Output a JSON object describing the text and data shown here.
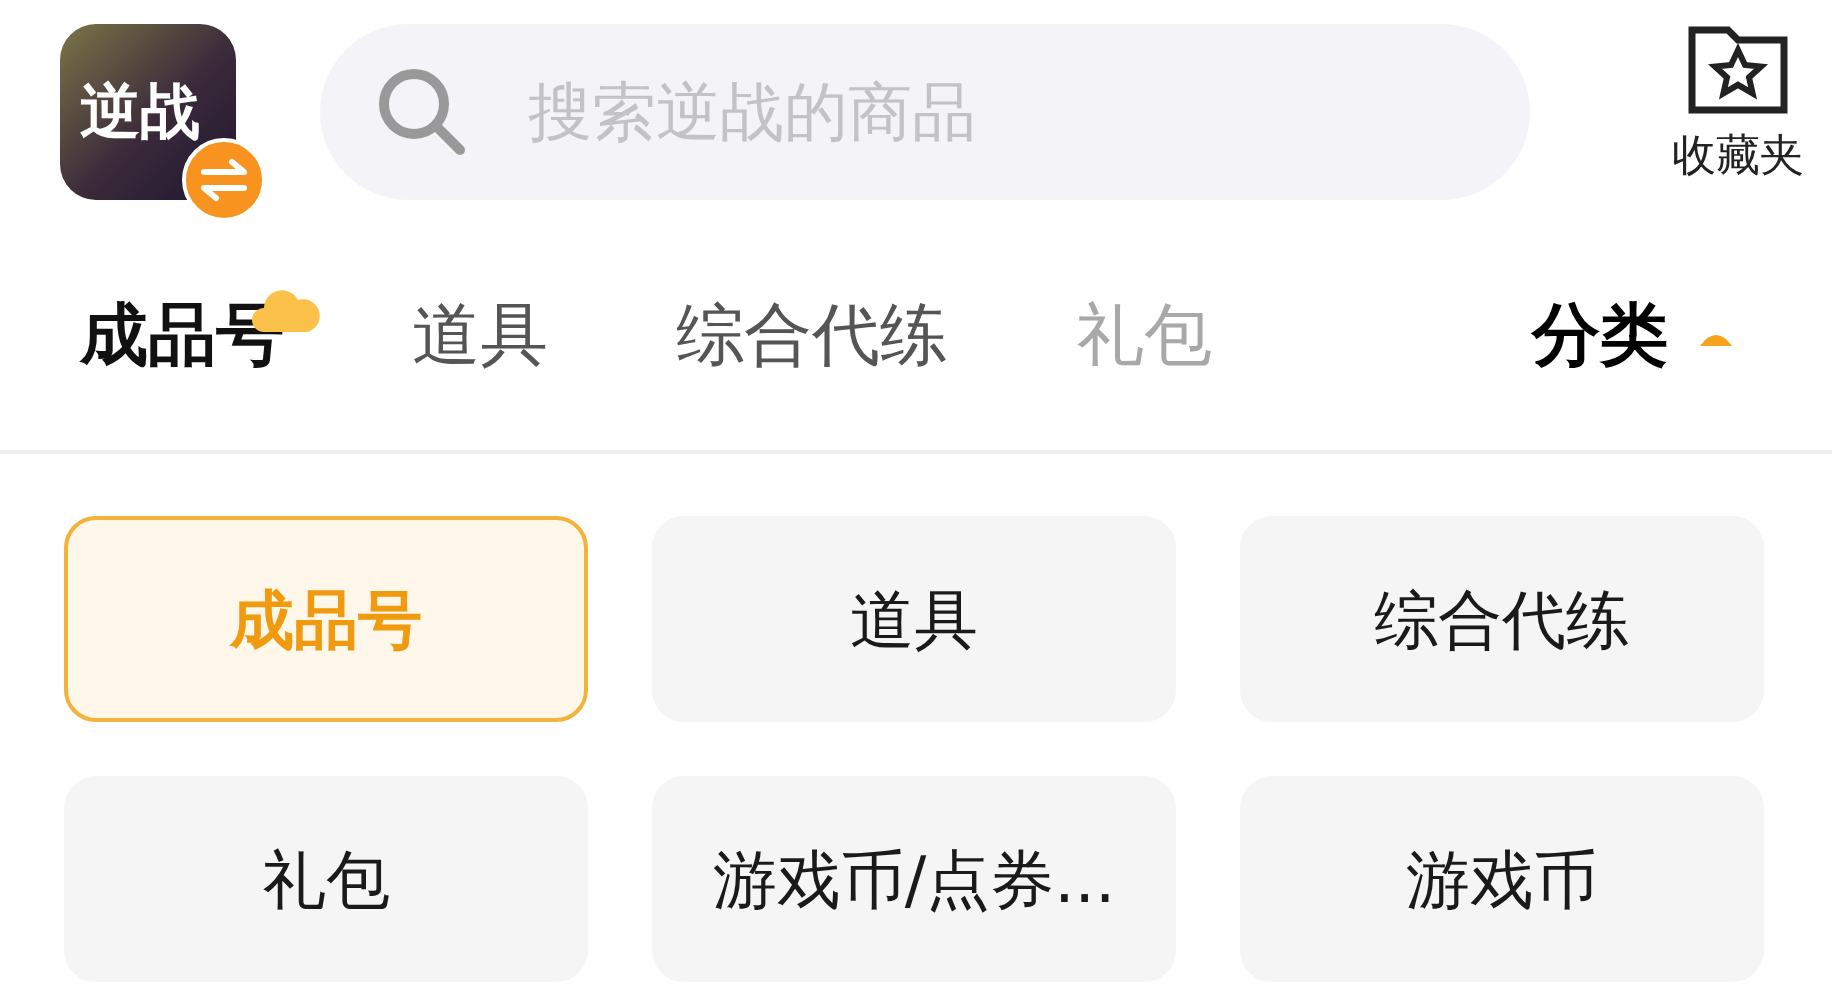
{
  "app_icon": {
    "label": "逆战"
  },
  "search": {
    "placeholder": "搜索逆战的商品"
  },
  "favorites": {
    "label": "收藏夹"
  },
  "tabs": [
    {
      "label": "成品号",
      "selected": true
    },
    {
      "label": "道具",
      "selected": false
    },
    {
      "label": "综合代练",
      "selected": false
    },
    {
      "label": "礼包",
      "selected": false
    }
  ],
  "category_toggle": {
    "label": "分类",
    "expanded": true
  },
  "categories": [
    {
      "label": "成品号",
      "selected": true
    },
    {
      "label": "道具",
      "selected": false
    },
    {
      "label": "综合代练",
      "selected": false
    },
    {
      "label": "礼包",
      "selected": false
    },
    {
      "label": "游戏币/点券...",
      "selected": false
    },
    {
      "label": "游戏币",
      "selected": false
    }
  ]
}
